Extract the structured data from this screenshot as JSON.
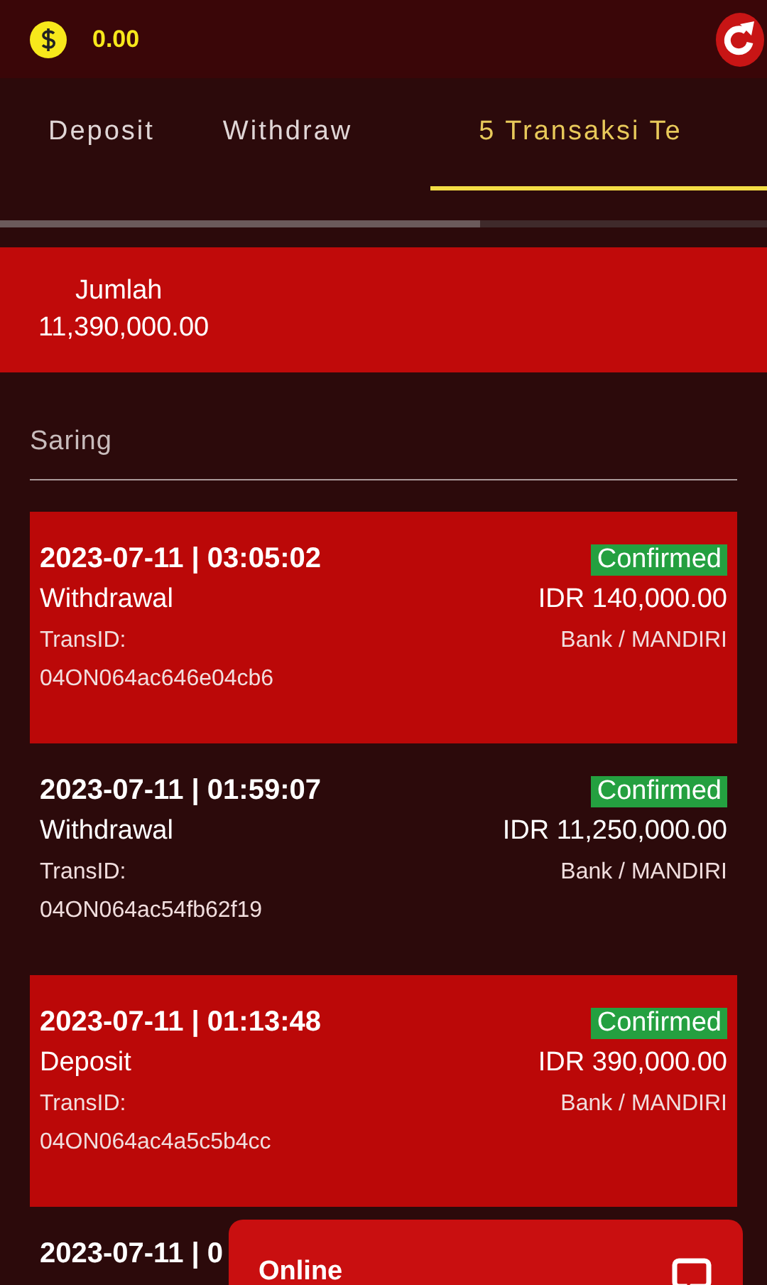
{
  "balance": "0.00",
  "tabs": [
    {
      "label": "Deposit",
      "selected": false
    },
    {
      "label": "Withdraw",
      "selected": false
    },
    {
      "label": "5 Transaksi Te",
      "selected": true
    }
  ],
  "summary": {
    "label": "Jumlah",
    "value": "11,390,000.00"
  },
  "filter": {
    "label": "Saring"
  },
  "transactions": [
    {
      "highlighted": true,
      "datetime": "2023-07-11 | 03:05:02",
      "status": "Confirmed",
      "type": "Withdrawal",
      "amount": "IDR 140,000.00",
      "id_label": "TransID:",
      "method": "Bank / MANDIRI",
      "id": "04ON064ac646e04cb6"
    },
    {
      "highlighted": false,
      "datetime": "2023-07-11 | 01:59:07",
      "status": "Confirmed",
      "type": "Withdrawal",
      "amount": "IDR 11,250,000.00",
      "id_label": "TransID:",
      "method": "Bank / MANDIRI",
      "id": "04ON064ac54fb62f19"
    },
    {
      "highlighted": true,
      "datetime": "2023-07-11 | 01:13:48",
      "status": "Confirmed",
      "type": "Deposit",
      "amount": "IDR 390,000.00",
      "id_label": "TransID:",
      "method": "Bank / MANDIRI",
      "id": "04ON064ac4a5c5b4cc"
    },
    {
      "highlighted": false,
      "datetime": "2023-07-11 | 0"
    }
  ],
  "chat": {
    "label": "Online"
  }
}
